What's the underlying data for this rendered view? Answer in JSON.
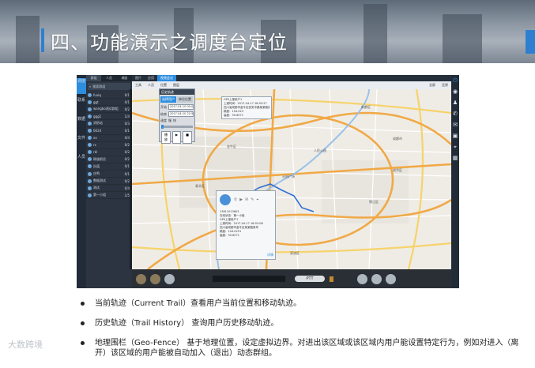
{
  "slide": {
    "title": "四、功能演示之调度台定位"
  },
  "app": {
    "left_nav": [
      "调度",
      "联系",
      "数据",
      "文件",
      "人员"
    ],
    "panel": {
      "tabs": [
        "群组",
        "人员",
        "调度"
      ],
      "search": "搜索群组",
      "groups": [
        {
          "name": "fuxiq",
          "count": "0/1"
        },
        {
          "name": "ggt",
          "count": "0/1"
        },
        {
          "name": "wangbo测试群组",
          "count": "0/2"
        },
        {
          "name": "ggg1",
          "count": "1/4"
        },
        {
          "name": "消防站",
          "count": "0/3"
        },
        {
          "name": "0024",
          "count": "0/1"
        },
        {
          "name": "xx",
          "count": "0/4"
        },
        {
          "name": "rx",
          "count": "0/2"
        },
        {
          "name": "rkl",
          "count": "0/2"
        },
        {
          "name": "释放职员",
          "count": "0/2"
        },
        {
          "name": "队值",
          "count": "0/1"
        },
        {
          "name": "庄鸣",
          "count": "0/1"
        },
        {
          "name": "数据测试",
          "count": "0/2"
        },
        {
          "name": "测试",
          "count": "0/4"
        },
        {
          "name": "第一小组",
          "count": "1/5"
        }
      ]
    },
    "top_tabs": [
      "图片",
      "应用",
      "视频会议"
    ],
    "toolbar": [
      "工具",
      "人员",
      "位置",
      "图层"
    ],
    "toolbar_right": [
      "全屏",
      "还原"
    ],
    "trail_dialog": {
      "title": "历史轨迹",
      "tabs": [
        "选择用户",
        "单位位置"
      ],
      "start_label": "开始",
      "start_value": "2017-04-10 00:00",
      "end_label": "结束",
      "end_value": "2017-04-10 22:56",
      "speed_label": "速度",
      "slow_label": "慢",
      "fast_label": "快",
      "play_label": "播放"
    },
    "popup1": {
      "lines": [
        "GPS上报用户1",
        "上报时间：2017-04-17 16:03:27",
        "四川省成都市金牛区西安中路某某路某号",
        "精度：104.023",
        "高度：30.6571"
      ]
    },
    "popup2": {
      "lines": [
        "13811013603",
        "在线状态：第一小组",
        "",
        "GPS上报用户1",
        "上报时间：2017-04-17 16:03:08",
        "四川省成都市金牛区某某路某号",
        "精度：104.0251",
        "高度：30.6271"
      ],
      "foot": "详情"
    },
    "ptt_label": "PTT",
    "map_labels": [
      "天府广场",
      "成都市",
      "武侯区",
      "人民公园",
      "锦江区",
      "金牛区",
      "青羊区",
      "成华区",
      "新都区",
      "双流区"
    ]
  },
  "bullets": [
    "当前轨迹（Current Trail）查看用户当前位置和移动轨迹。",
    "历史轨迹（Trail History） 查询用户历史移动轨迹。",
    "地理围栏（Geo-Fence）   基于地理位置，设定虚拟边界。对进出该区域或该区域内用户能设置特定行为，例如对进入（离开）该区域的用户能被自动加入（退出）动态群组。"
  ],
  "watermark": "大数跨境",
  "colors": {
    "accent": "#2f7fd1",
    "app_dark": "#1b2430",
    "selected_tab": "#2d8ee0",
    "map_bg": "#efece6",
    "road_orange": "#f0a946",
    "road_yellow": "#f6d36b",
    "trail_blue": "#2f6fd6"
  }
}
